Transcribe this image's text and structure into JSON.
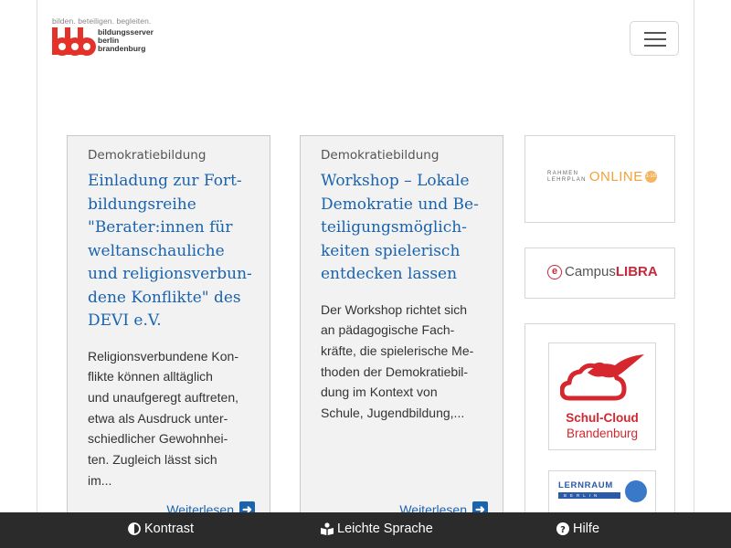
{
  "header": {
    "logo": {
      "tagline": "bilden. beteiligen. begleiten.",
      "wordmark": [
        "bildungsserver",
        "berlin",
        "brandenburg"
      ],
      "brand_color": "#e4322b"
    },
    "menu_icon": "hamburger-icon"
  },
  "cards": [
    {
      "category": "Demokratiebildung",
      "title_lines": [
        "Einladung zur Fort-",
        "bildungsreihe",
        "\"Berater:innen für",
        "weltanschauliche",
        "und religionsverbun-",
        "dene Konflikte\" des",
        "DEVI e.V."
      ],
      "body_lines": [
        "Religionsverbundene Kon-",
        "flikte können alltäglich",
        "und unaufgeregt auftreten,",
        "etwa als Ausdruck unter-",
        "schiedlicher Gewohnhei-",
        "ten. Zugleich lässt sich",
        "im..."
      ],
      "more_label": "Weiterlesen",
      "more_icon": "arrow-right-icon"
    },
    {
      "category": "Demokratiebildung",
      "title_lines": [
        "Workshop – Lokale",
        "Demokratie und Be-",
        "teiligungsmöglich-",
        "keiten spielerisch",
        "entdecken lassen"
      ],
      "body_lines": [
        "Der Workshop richtet sich",
        "an pädagogische Fach-",
        "kräfte, die spielerische Me-",
        "thoden der Demokratiebil-",
        "dung im Kontext von",
        "Schule, Jugendbildung,..."
      ],
      "more_label": "Weiterlesen",
      "more_icon": "arrow-right-icon"
    }
  ],
  "sidebar": {
    "rahmenlehrplan": {
      "small_1": "RAHMEN",
      "small_2": "LEHRPLAN",
      "online": "ONLINE",
      "badge": "1-10",
      "color": "#f2a23b"
    },
    "campuslibra": {
      "e": "e",
      "campus": "Campus",
      "libra": "LIBRA",
      "color": "#c32a3c"
    },
    "schulcloud": {
      "line1": "Schul-Cloud",
      "line2": "Brandenburg",
      "color": "#d6262e"
    },
    "lernraum": {
      "title": "LERNRAUM",
      "sub": "BERLIN",
      "color": "#2a5aa8"
    }
  },
  "footer": {
    "items": [
      {
        "label": "Kontrast",
        "icon": "contrast-icon"
      },
      {
        "label": "Leichte Sprache",
        "icon": "book-reader-icon"
      },
      {
        "label": "Hilfe",
        "icon": "question-circle-icon"
      }
    ]
  }
}
